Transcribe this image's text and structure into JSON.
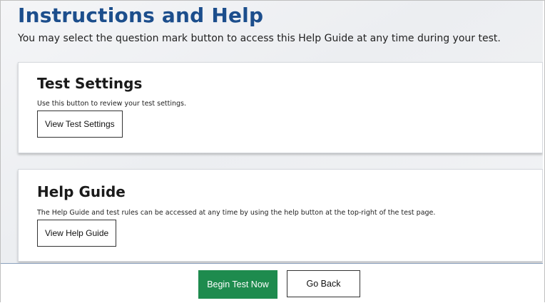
{
  "header": {
    "title": "Instructions and Help",
    "subtitle": "You may select the question mark button to access this Help Guide at any time during your test."
  },
  "sections": {
    "test_settings": {
      "heading": "Test Settings",
      "description": "Use this button to review your test settings.",
      "button_label": "View Test Settings"
    },
    "help_guide": {
      "heading": "Help Guide",
      "description": "The Help Guide and test rules can be accessed at any time by using the help button at the top-right of the test page.",
      "button_label": "View Help Guide"
    }
  },
  "footer": {
    "begin_label": "Begin Test Now",
    "back_label": "Go Back"
  },
  "colors": {
    "title": "#1c4e8c",
    "primary_button": "#1e8b4e"
  }
}
